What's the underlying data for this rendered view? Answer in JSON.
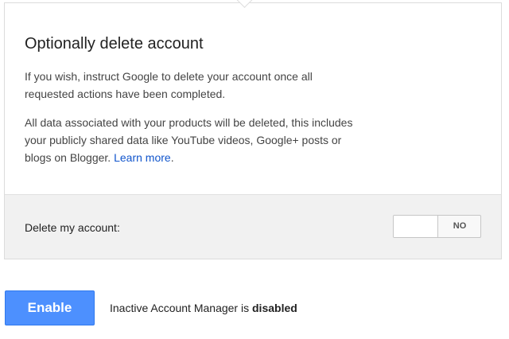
{
  "card": {
    "title": "Optionally delete account",
    "paragraph1": "If you wish, instruct Google to delete your account once all requested actions have been completed.",
    "paragraph2_text": "All data associated with your products will be deleted, this includes your publicly shared data like YouTube videos, Google+ posts or blogs on Blogger. ",
    "learn_more_label": "Learn more",
    "paragraph2_end": "."
  },
  "delete_account": {
    "label": "Delete my account:",
    "toggle_value": "NO"
  },
  "actions": {
    "enable_label": "Enable",
    "status_prefix": "Inactive Account Manager is ",
    "status_value": "disabled"
  },
  "colors": {
    "primary_button": "#4d90fe",
    "link": "#1155cc",
    "footer_bg": "#f1f1f1"
  }
}
